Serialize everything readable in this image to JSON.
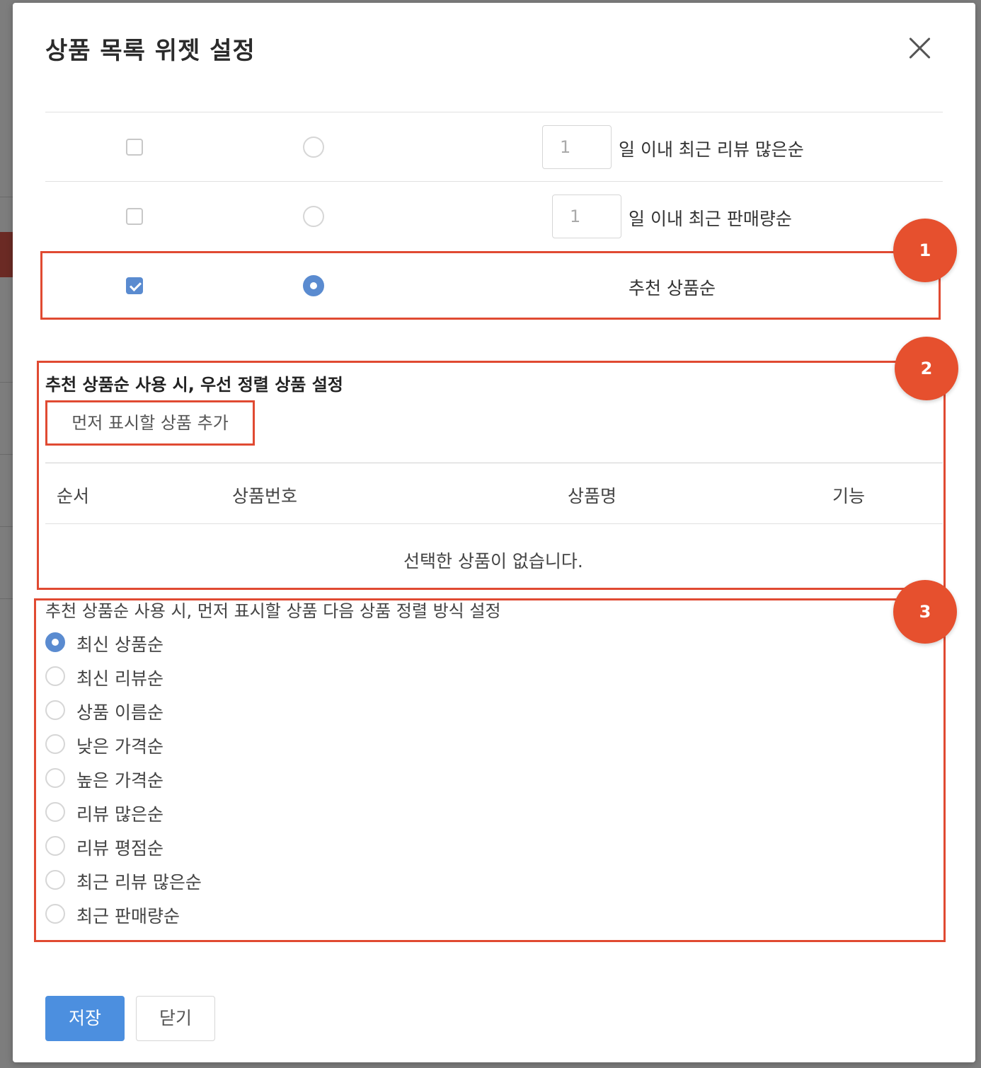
{
  "modal": {
    "title": "상품 목록 위젯 설정",
    "close_label": "×"
  },
  "sort_rows": [
    {
      "checked": false,
      "selected": false,
      "days_value": "1",
      "label": "일 이내 최근 리뷰 많은순"
    },
    {
      "checked": false,
      "selected": false,
      "days_value": "1",
      "label": "일 이내 최근 판매량순"
    },
    {
      "checked": true,
      "selected": true,
      "label": "추천 상품순"
    }
  ],
  "annotations": [
    "1",
    "2",
    "3"
  ],
  "priority_section": {
    "title": "추천 상품순 사용 시, 우선 정렬 상품 설정",
    "add_button": "먼저 표시할 상품 추가",
    "columns": [
      "순서",
      "상품번호",
      "상품명",
      "기능"
    ],
    "empty_message": "선택한 상품이 없습니다."
  },
  "next_sort_section": {
    "title": "추천 상품순 사용 시, 먼저 표시할 상품 다음 상품 정렬 방식 설정",
    "options": [
      "최신 상품순",
      "최신 리뷰순",
      "상품 이름순",
      "낮은 가격순",
      "높은 가격순",
      "리뷰 많은순",
      "리뷰 평점순",
      "최근 리뷰 많은순",
      "최근 판매량순"
    ],
    "selected_index": 0
  },
  "footer": {
    "save_label": "저장",
    "close_label": "닫기"
  },
  "colors": {
    "accent_blue": "#4c8fdf",
    "annotation_red": "#e04a32"
  }
}
